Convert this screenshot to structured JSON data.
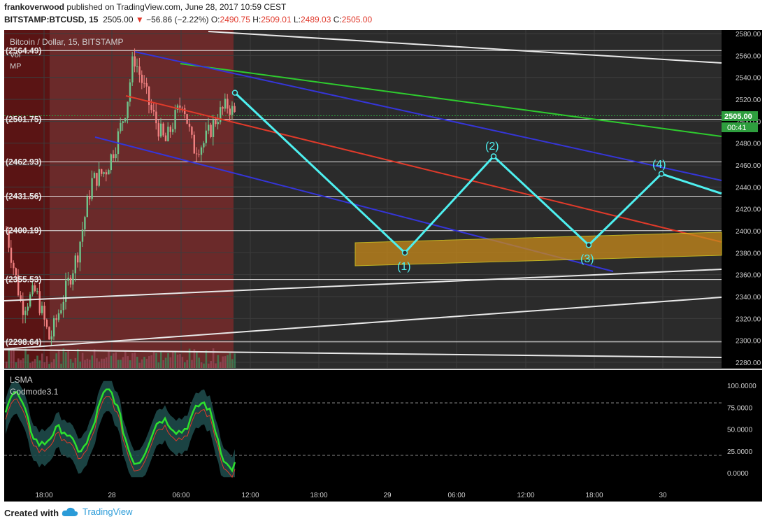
{
  "header": {
    "author": "frankoverwood",
    "published_text": "published on TradingView.com, June 28, 2017 10:59 CEST",
    "symbol": "BITSTAMP:BTCUSD, 15",
    "price": "2505.00",
    "change_arrow": "▼",
    "change": "−56.86 (−2.22%)",
    "o_label": "O:",
    "o_value": "2490.75",
    "h_label": "H:",
    "h_value": "2509.01",
    "l_label": "L:",
    "l_value": "2489.03",
    "c_label": "C:",
    "c_value": "2505.00"
  },
  "legend": {
    "title": "Bitcoin / Dollar, 15, BITSTAMP",
    "vol": "Vol",
    "mp": "MP",
    "osc1": "LSMA",
    "osc2": "Godmode3.1"
  },
  "price_axis": {
    "ticks": [
      "2580.00",
      "2560.00",
      "2540.00",
      "2520.00",
      "2500.00",
      "2480.00",
      "2460.00",
      "2440.00",
      "2420.00",
      "2400.00",
      "2380.00",
      "2360.00",
      "2340.00",
      "2320.00",
      "2300.00",
      "2280.00"
    ],
    "current_price": "2505.00",
    "countdown": "00:41"
  },
  "osc_axis": {
    "ticks": [
      "100.0000",
      "75.0000",
      "50.0000",
      "25.0000",
      "0.0000"
    ]
  },
  "time_axis": {
    "labels": [
      "18:00",
      "28",
      "06:00",
      "12:00",
      "18:00",
      "29",
      "06:00",
      "12:00",
      "18:00",
      "30"
    ]
  },
  "level_labels": [
    "(2564.49)",
    "(2501.75)",
    "(2462.93)",
    "(2431.56)",
    "(2400.19)",
    "(2355.53)",
    "(2298.64)"
  ],
  "wave_labels": [
    "(1)",
    "(2)",
    "(3)",
    "(4)"
  ],
  "colors": {
    "bg_dark": "#2b2b2b",
    "bg_black": "#000000",
    "zone_red": "#6b2a2a",
    "cyan": "#4ef0f0",
    "green_line": "#2ecc2e",
    "blue_line": "#3535d8",
    "red_line": "#e03a2a",
    "orange_box": "#c98a1a",
    "up_candle": "#6fc48a",
    "down_candle": "#f08080"
  },
  "footer": {
    "created_with": "Created with",
    "brand": "TradingView"
  },
  "chart_data": {
    "type": "candlestick",
    "symbol": "BITSTAMP:BTCUSD",
    "timeframe": "15",
    "ohlc_last": {
      "open": 2490.75,
      "high": 2509.01,
      "low": 2489.03,
      "close": 2505.0
    },
    "ylim": [
      2275,
      2585
    ],
    "horizontal_levels": [
      2564.49,
      2501.75,
      2462.93,
      2431.56,
      2400.19,
      2355.53,
      2298.64
    ],
    "wave_projection": [
      {
        "label": "",
        "price": 2526
      },
      {
        "label": "(1)",
        "price": 2380
      },
      {
        "label": "(2)",
        "price": 2468
      },
      {
        "label": "(3)",
        "price": 2387
      },
      {
        "label": "(4)",
        "price": 2452
      },
      {
        "label": "",
        "price": 2434
      }
    ],
    "support_zone": [
      2378,
      2398
    ],
    "oscillator": {
      "name": "Godmode3.1",
      "ylim": [
        -5,
        105
      ],
      "levels": [
        80,
        20
      ]
    }
  }
}
